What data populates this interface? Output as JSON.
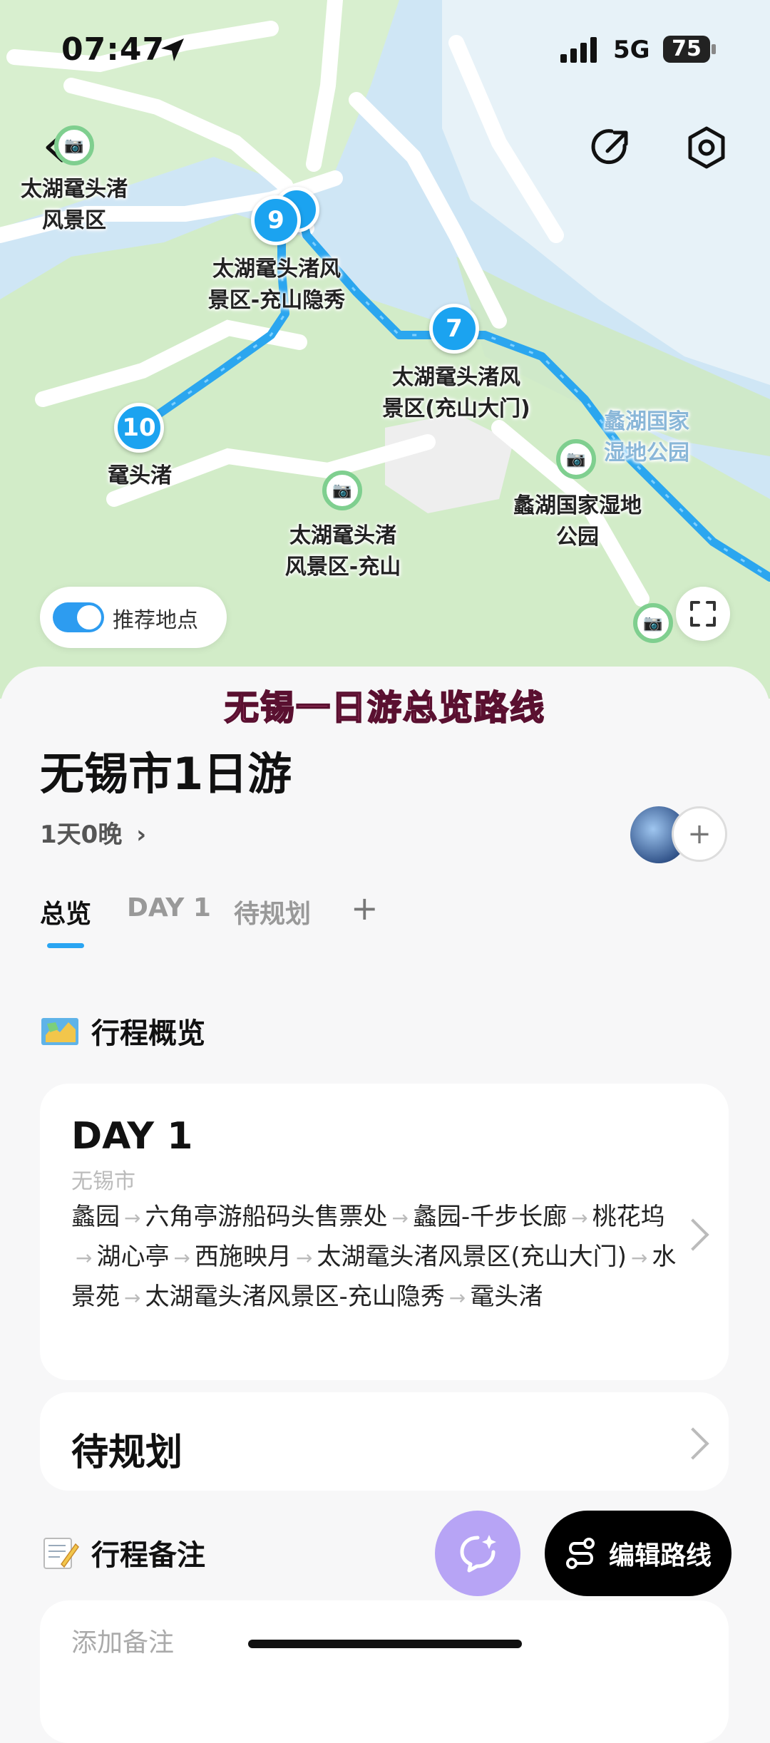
{
  "status_bar": {
    "time": "07:47",
    "network": "5G",
    "battery": "75"
  },
  "map": {
    "pins": [
      {
        "num": "9"
      },
      {
        "num": "7"
      },
      {
        "num": "10"
      }
    ],
    "labels": [
      {
        "text": "太湖鼋头渚\n风景区"
      },
      {
        "text": "太湖鼋头渚风\n景区-充山隐秀"
      },
      {
        "text": "太湖鼋头渚风\n景区(充山大门)"
      },
      {
        "text": "鼋头渚"
      },
      {
        "text": "太湖鼋头渚\n风景区-充山"
      },
      {
        "text": "蠡湖国家湿地\n公园"
      },
      {
        "text": "蠡湖国家\n湿地公园"
      }
    ],
    "toggle_label": "推荐地点"
  },
  "caption": "无锡一日游总览路线",
  "trip": {
    "title": "无锡市1日游",
    "duration": "1天0晚"
  },
  "tabs": [
    "总览",
    "DAY 1",
    "待规划",
    "+"
  ],
  "overview": {
    "heading": "行程概览",
    "day_title": "DAY 1",
    "day_city": "无锡市",
    "route": [
      "蠡园",
      "六角亭游船码头售票处",
      "蠡园-千步长廊",
      "桃花坞",
      "湖心亭",
      "西施映月",
      "太湖鼋头渚风景区(充山大门)",
      "水景苑",
      "太湖鼋头渚风景区-充山隐秀",
      "鼋头渚"
    ],
    "arrow": "→"
  },
  "pending": {
    "label": "待规划"
  },
  "notes": {
    "heading": "行程备注",
    "placeholder": "添加备注"
  },
  "edit_button": "编辑路线",
  "colors": {
    "accent": "#1ba3f0",
    "map_land": "#cfe9c9",
    "map_water": "#cfe6f5",
    "fab_ai": "#b7a4f5"
  }
}
